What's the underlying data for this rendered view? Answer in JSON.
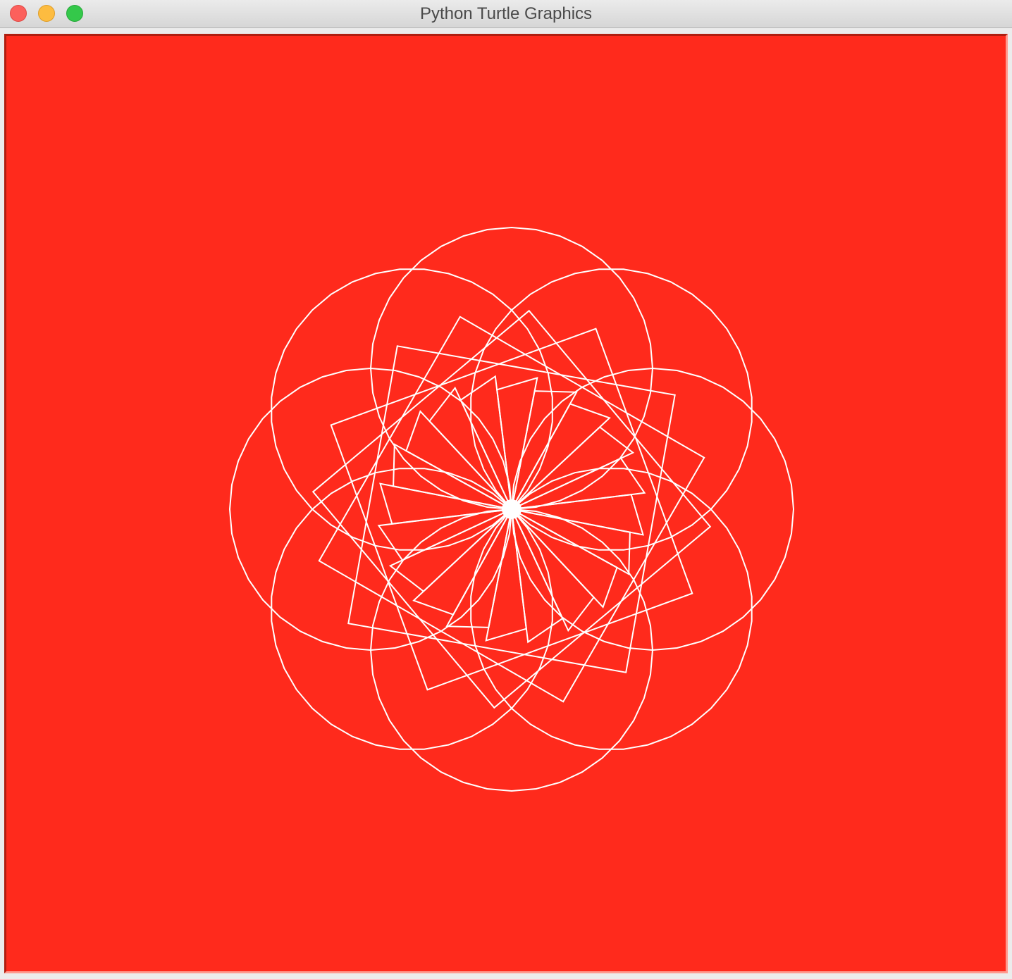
{
  "window": {
    "title": "Python Turtle Graphics",
    "buttons": {
      "close": "close",
      "minimize": "minimize",
      "maximize": "zoom"
    }
  },
  "canvas": {
    "background_color": "#ff2a1c",
    "pen_color": "#ffffff",
    "drawing": {
      "circles": {
        "count": 8,
        "sides": 36
      },
      "squares": {
        "count": 4
      },
      "star_lines": {
        "count": 20
      }
    }
  }
}
